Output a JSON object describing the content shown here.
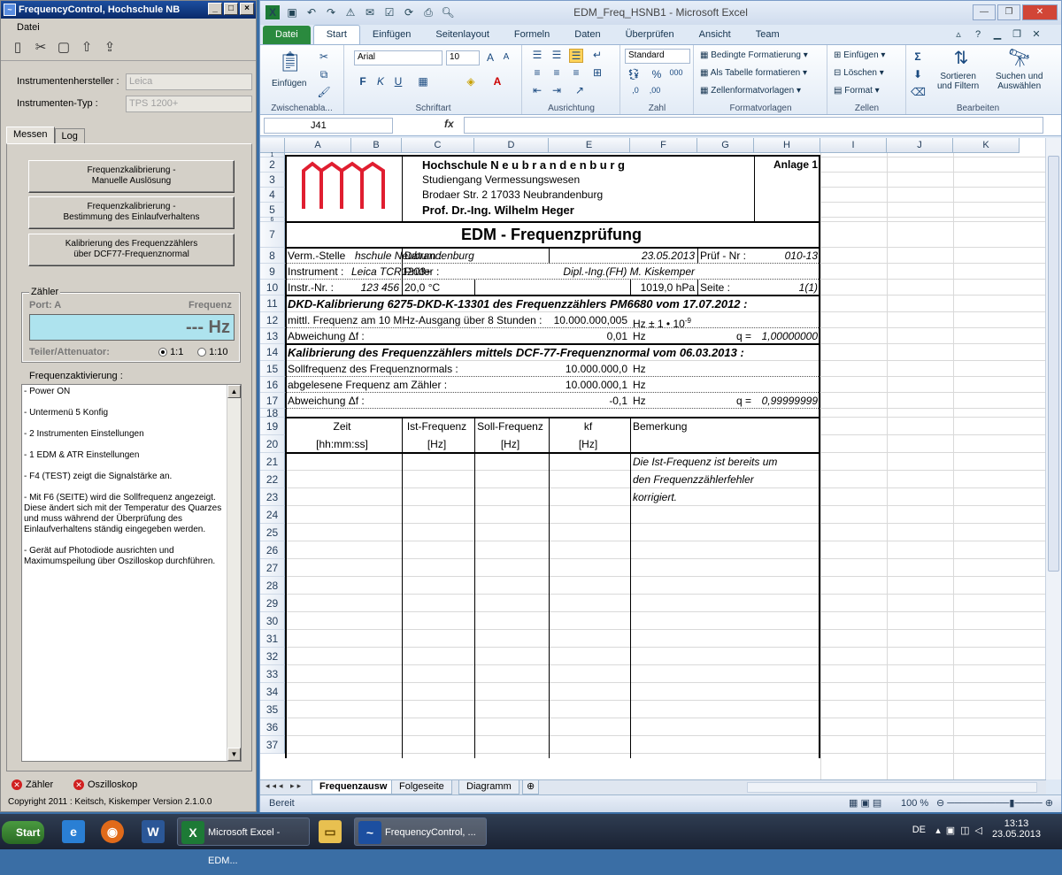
{
  "fc": {
    "title": "FrequencyControl,  Hochschule NB",
    "menu": "Datei",
    "manufacturer_label": "Instrumentenhersteller :",
    "manufacturer_value": "Leica",
    "type_label": "Instrumenten-Typ :",
    "type_value": "TPS 1200+",
    "tabs": [
      "Messen",
      "Log"
    ],
    "btn1": [
      "Frequenzkalibrierung -",
      "Manuelle Auslösung"
    ],
    "btn2": [
      "Frequenzkalibrierung -",
      "Bestimmung des Einlaufverhaltens"
    ],
    "btn3": [
      "Kalibrierung des Frequenzzählers",
      "über DCF77-Frequenznormal"
    ],
    "counter_label": "Zähler",
    "port": "Port: A",
    "freq_label": "Frequenz",
    "freq_display": "--- Hz",
    "divider_label": "Teiler/Attenuator:",
    "opt1": "1:1",
    "opt2": "1:10",
    "activation_label": "Frequenzaktivierung :",
    "activation_text": [
      "- Power ON",
      "- Untermenü 5 Konfig",
      "- 2 Instrumenten Einstellungen",
      "- 1 EDM & ATR Einstellungen",
      "- F4 (TEST) zeigt die Signalstärke an.",
      "- Mit F6 (SEITE) wird die Sollfrequenz angezeigt. Diese ändert sich mit der Temperatur des Quarzes und muss während der Überprüfung des Einlaufverhaltens ständig eingegeben werden.",
      "- Gerät auf Photodiode ausrichten und Maximumspeilung über Oszilloskop durchführen."
    ],
    "status1": "Zähler",
    "status2": "Oszilloskop",
    "copyright": "Copyright 2011 :  Keitsch,  Kiskemper   Version 2.1.0.0"
  },
  "xl": {
    "title": "EDM_Freq_HSNB1  -  Microsoft Excel",
    "tabs": [
      "Datei",
      "Start",
      "Einfügen",
      "Seitenlayout",
      "Formeln",
      "Daten",
      "Überprüfen",
      "Ansicht",
      "Team"
    ],
    "ribbon": {
      "einfuegen": "Einfügen",
      "zw": "Zwischenabla...",
      "font": "Arial",
      "size": "10",
      "schriftart": "Schriftart",
      "ausrichtung": "Ausrichtung",
      "numfmt": "Standard",
      "zahl": "Zahl",
      "bedingte": "Bedingte Formatierung",
      "tabelle": "Als Tabelle formatieren",
      "zellfmt": "Zellenformatvorlagen",
      "formatvorlagen": "Formatvorlagen",
      "einf2": "Einfügen",
      "loeschen": "Löschen",
      "format": "Format",
      "zellen": "Zellen",
      "sortieren": [
        "Sortieren",
        "und Filtern"
      ],
      "suchen": [
        "Suchen und",
        "Auswählen"
      ],
      "bearbeiten": "Bearbeiten"
    },
    "namebox": "J41",
    "columns": [
      "A",
      "B",
      "C",
      "D",
      "E",
      "F",
      "G",
      "H",
      "I",
      "J",
      "K"
    ],
    "sheet": {
      "h1": "Hochschule  N e u b r a n d e n b u r g",
      "h2": "Studiengang Vermessungswesen",
      "h3": "Brodaer Str. 2        17033 Neubrandenburg",
      "h4": "Prof. Dr.-Ing.  Wilhelm Heger",
      "anlage": "Anlage 1",
      "main_title": "EDM - Frequenzprüfung",
      "r8": [
        "Verm.-Stelle",
        "hschule Neubrandenburg",
        "Datum :",
        "23.05.2013",
        "Prüf - Nr :",
        "010-13"
      ],
      "r9": [
        "Instrument :",
        "Leica TCR1203+",
        "Prüfer :",
        "Dipl.-Ing.(FH) M. Kiskemper"
      ],
      "r10": [
        "Instr.-Nr. :",
        "123 456",
        "20,0 °C",
        "1019,0 hPa",
        "Seite :",
        "1(1)"
      ],
      "r11": "DKD-Kalibrierung 6275-DKD-K-13301 des Frequenzzählers PM6680 vom 17.07.2012 :",
      "r12": [
        "mittl. Frequenz am 10 MHz-Ausgang über 8 Stunden :",
        "10.000.000,005",
        "Hz ± 1 • 10",
        "-9"
      ],
      "r13": [
        "Abweichung Δf :",
        "0,01",
        "Hz",
        "q =",
        "1,00000000"
      ],
      "r14": "Kalibrierung des Frequenzzählers mittels DCF-77-Frequenznormal vom 06.03.2013 :",
      "r15": [
        "Sollfrequenz des Frequenznormals :",
        "10.000.000,0",
        "Hz"
      ],
      "r16": [
        "abgelesene Frequenz am Zähler :",
        "10.000.000,1",
        "Hz"
      ],
      "r17": [
        "Abweichung Δf :",
        "-0,1",
        "Hz",
        "q =",
        "0,99999999"
      ],
      "r19": [
        "Zeit",
        "Ist-Frequenz",
        "Soll-Frequenz",
        "kf",
        "Bemerkung"
      ],
      "r20": [
        "[hh:mm:ss]",
        "[Hz]",
        "[Hz]",
        "[Hz]"
      ],
      "remark": [
        "Die Ist-Frequenz ist bereits um",
        "den Frequenzzählerfehler",
        "korrigiert."
      ]
    },
    "sheet_tabs": [
      "Frequenzausw",
      "Folgeseite",
      "Diagramm"
    ],
    "status": "Bereit",
    "zoom": "100 %"
  },
  "taskbar": {
    "start": "Start",
    "excel": "Microsoft Excel - EDM...",
    "fc": "FrequencyControl, ...",
    "lang": "DE",
    "time": "13:13",
    "date": "23.05.2013"
  }
}
